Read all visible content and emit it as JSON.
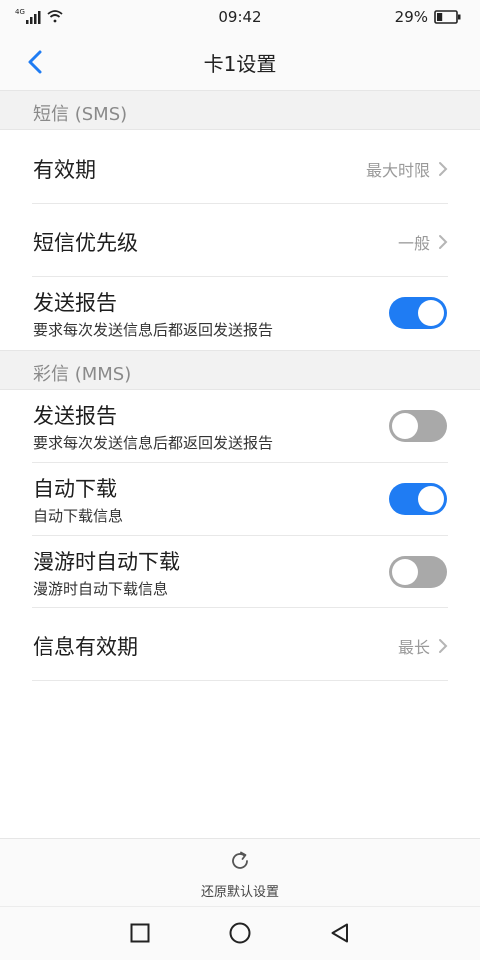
{
  "status_bar": {
    "network": "4G",
    "time": "09:42",
    "battery_percent": "29%",
    "battery_level": 0.29,
    "icons": [
      "signal-icon",
      "wifi-icon",
      "battery-icon"
    ]
  },
  "header": {
    "title": "卡1设置",
    "back_icon": "chevron-left-icon"
  },
  "sections": {
    "sms": {
      "label": "短信 (SMS)",
      "rows": [
        {
          "title": "有效期",
          "value": "最大时限"
        },
        {
          "title": "短信优先级",
          "value": "一般"
        },
        {
          "title": "发送报告",
          "subtitle": "要求每次发送信息后都返回发送报告",
          "toggle": true
        }
      ]
    },
    "mms": {
      "label": "彩信 (MMS)",
      "rows": [
        {
          "title": "发送报告",
          "subtitle": "要求每次发送信息后都返回发送报告",
          "toggle": false
        },
        {
          "title": "自动下载",
          "subtitle": "自动下载信息",
          "toggle": true
        },
        {
          "title": "漫游时自动下载",
          "subtitle": "漫游时自动下载信息",
          "toggle": false
        },
        {
          "title": "信息有效期",
          "value": "最长"
        }
      ]
    }
  },
  "footer": {
    "reset_label": "还原默认设置",
    "reset_icon": "refresh-icon"
  },
  "nav_bar": {
    "icons": [
      "recent-apps-icon",
      "home-icon",
      "back-icon"
    ]
  },
  "colors": {
    "accent": "#1f7cf3",
    "toggle_off": "#a9a9a9",
    "section_bg": "#f2f2f2",
    "value_text": "#9a9a9a"
  }
}
